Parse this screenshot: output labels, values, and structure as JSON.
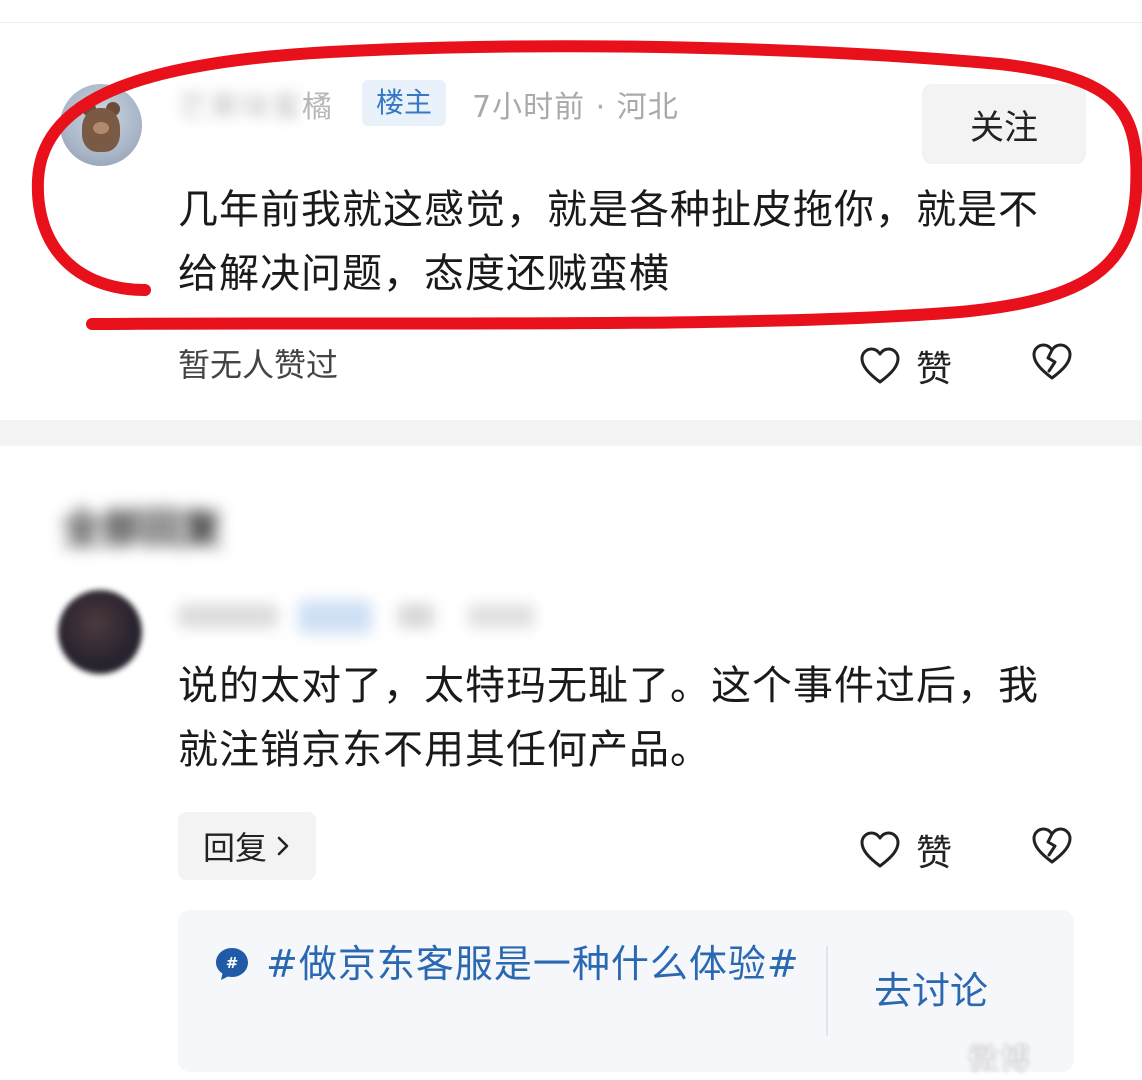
{
  "op_comment": {
    "username_visible": "橘",
    "username_masked": "芒果味蜜",
    "badge": "楼主",
    "meta": "7小时前 · 河北",
    "follow_label": "关注",
    "text": "几年前我就这感觉，就是各种扯皮拖你，就是不给解决问题，态度还贼蛮横",
    "likes_status": "暂无人赞过",
    "like_label": "赞",
    "avatar_icon": "teddy-bear-avatar"
  },
  "replies_section": {
    "title": "全部回复"
  },
  "reply_comment": {
    "text": "说的太对了，太特玛无耻了。这个事件过后，我就注销京东不用其任何产品。",
    "reply_label": "回复",
    "like_label": "赞",
    "avatar_icon": "dark-avatar"
  },
  "topic_card": {
    "topic": "#做京东客服是一种什么体验#",
    "action_label": "去讨论",
    "icon": "hashtag-bubble-icon"
  },
  "annotation": {
    "color": "#e8101a",
    "shape": "hand-drawn-ellipse"
  },
  "watermark": {
    "text": "微博"
  },
  "colors": {
    "accent_blue": "#2a68b2",
    "badge_bg": "#e9f1fb",
    "muted_text": "#a9a9a9"
  }
}
